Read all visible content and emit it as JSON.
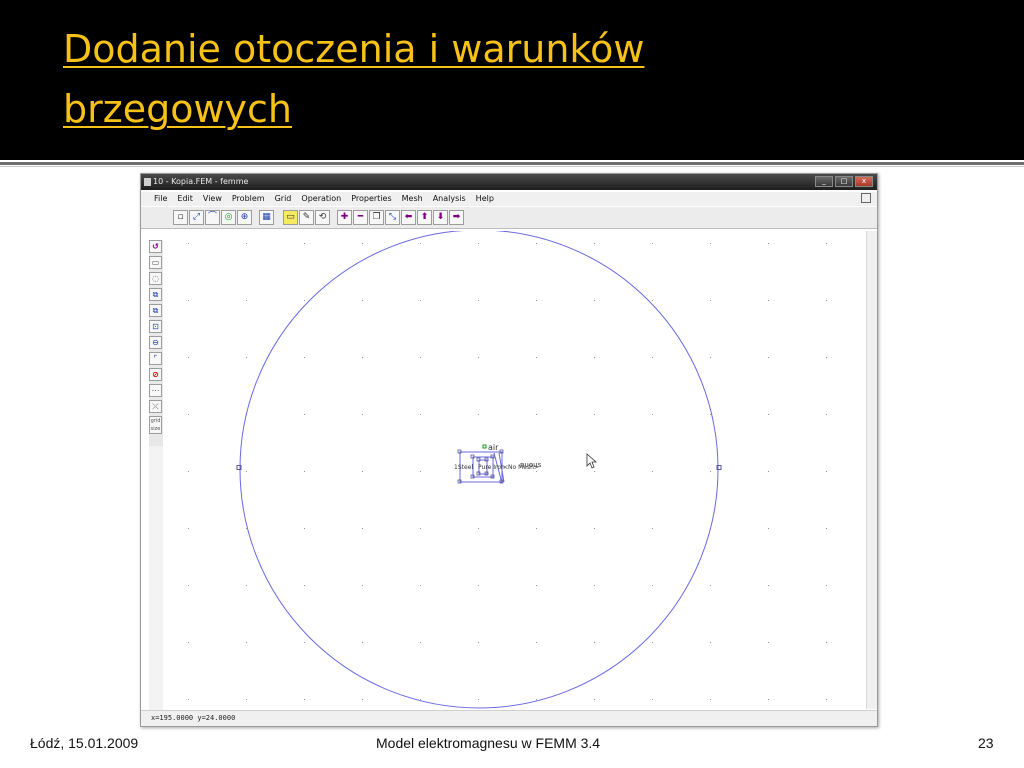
{
  "slide": {
    "title_line_1": "Dodanie otoczenia i warunków",
    "title_line_2": "brzegowych",
    "footer_left": "Łódź, 15.01.2009",
    "footer_center": "Model elektromagnesu w FEMM 3.4",
    "footer_right": "23"
  },
  "window": {
    "title": "10 - Kopia.FEM - femme",
    "controls": {
      "minimize": "_",
      "maximize": "□",
      "close": "x"
    },
    "menu": [
      "File",
      "Edit",
      "View",
      "Problem",
      "Grid",
      "Operation",
      "Properties",
      "Mesh",
      "Analysis",
      "Help"
    ],
    "status_text": "x=195.0000 y=24.0000"
  },
  "canvas": {
    "labels": {
      "air": "air",
      "left_material": "1Steel",
      "right_material": "<No Mesh>",
      "right_material_2": "nuous",
      "inner_label": "Pure Iron"
    },
    "colors": {
      "boundary": "#6a6ae0",
      "node": "#5a5a9a",
      "grid_dot": "#999999",
      "block_marker": "#1a9a1a"
    }
  },
  "toolbar": {
    "top_groups": [
      [
        "▫",
        "⤢",
        "⌒",
        "◎",
        "⊕"
      ],
      [
        "▦"
      ],
      [
        "▭",
        "✎",
        "⟲"
      ],
      [
        "✚",
        "━",
        "❐",
        "⤡",
        "⬅",
        "⬆",
        "⬇",
        "➡"
      ]
    ],
    "left": [
      "↺",
      "▭",
      "◌",
      "⧉",
      "⧉",
      "⊡",
      "⊖",
      "⌜",
      "⊘",
      "⋯",
      "⤫",
      "grid size"
    ]
  },
  "theme": {
    "title_color": "#f7c217",
    "band_color": "#000000"
  }
}
